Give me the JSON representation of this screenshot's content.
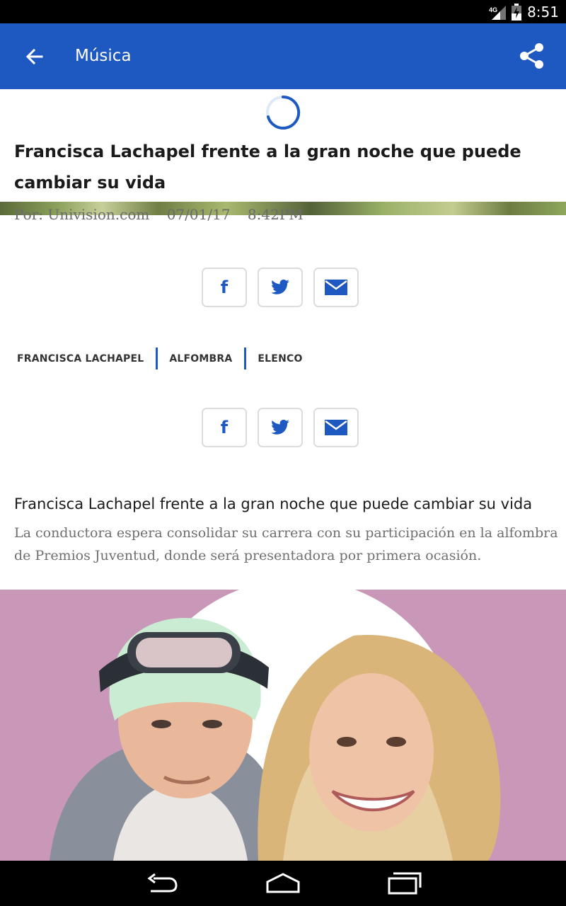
{
  "status_bar": {
    "network": "4G",
    "time": "8:51"
  },
  "app_bar": {
    "title": "Música",
    "back_icon": "arrow-left-icon",
    "share_icon": "share-icon",
    "color": "#1e58c1"
  },
  "article": {
    "headline": "Francisca Lachapel frente a la gran noche que puede cambiar su vida",
    "byline": {
      "author": "Por: Univision.com",
      "date": "07/01/17",
      "time": "8:42PM"
    }
  },
  "social_buttons": [
    {
      "name": "facebook",
      "icon": "facebook-icon",
      "glyph": "f"
    },
    {
      "name": "twitter",
      "icon": "twitter-icon"
    },
    {
      "name": "email",
      "icon": "envelope-icon"
    }
  ],
  "tags": [
    "FRANCISCA LACHAPEL",
    "ALFOMBRA",
    "ELENCO"
  ],
  "related": {
    "title": "Francisca Lachapel frente a la gran noche que puede cambiar su vida",
    "description": "La conductora espera consolidar su carrera con su participación en la alfombra de Premios Juventud, donde será presentadora por primera ocasión."
  },
  "colors": {
    "accent": "#1e58c1",
    "hero_background": "#c998b9"
  },
  "nav_bar": {
    "icons": [
      "back-nav-icon",
      "home-nav-icon",
      "recents-nav-icon"
    ]
  }
}
